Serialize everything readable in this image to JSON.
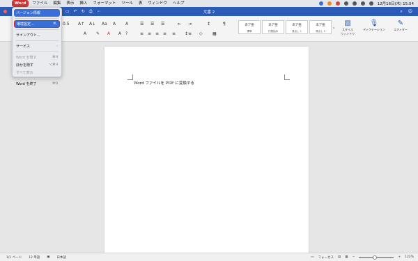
{
  "menubar": {
    "app": "Word",
    "items": [
      "ファイル",
      "編集",
      "表示",
      "挿入",
      "フォーマット",
      "ツール",
      "表",
      "ウィンドウ",
      "ヘルプ"
    ],
    "clock": "12月16日(木) 15:54"
  },
  "window": {
    "title": "文書 2"
  },
  "app_menu": {
    "items": [
      {
        "label": "バージョン情報",
        "shortcut": "",
        "disabled": false
      },
      {
        "label": "環境設定...",
        "shortcut": "⌘,",
        "disabled": false
      },
      {
        "label": "サインアウト...",
        "shortcut": "",
        "disabled": false
      },
      {
        "label": "サービス",
        "shortcut": "›",
        "disabled": false
      },
      {
        "label": "Word を隠す",
        "shortcut": "⌘H",
        "disabled": true
      },
      {
        "label": "ほかを隠す",
        "shortcut": "⌥⌘H",
        "disabled": false
      },
      {
        "label": "すべて表示",
        "shortcut": "",
        "disabled": true
      },
      {
        "label": "Word を終了",
        "shortcut": "⌘Q",
        "disabled": false
      }
    ]
  },
  "ribbon": {
    "font_size": "0.5",
    "styles": [
      {
        "sample": "あア亜",
        "label": "標準"
      },
      {
        "sample": "あア亜",
        "label": "行間詰め"
      },
      {
        "sample": "あア亜",
        "label": "見出し 1"
      },
      {
        "sample": "あア亜",
        "label": "見出し 2"
      }
    ],
    "style_pane_label": "スタイル\nウィンドウ",
    "dictation_label": "ディクテーション",
    "editor_label": "エディター"
  },
  "document": {
    "text": "Word ファイルを PDF に変換する"
  },
  "status": {
    "page": "1/1 ページ",
    "words": "12 単語",
    "language": "日本語",
    "focus": "フォーカス",
    "zoom": "122%",
    "zoom_level": 0.45
  }
}
